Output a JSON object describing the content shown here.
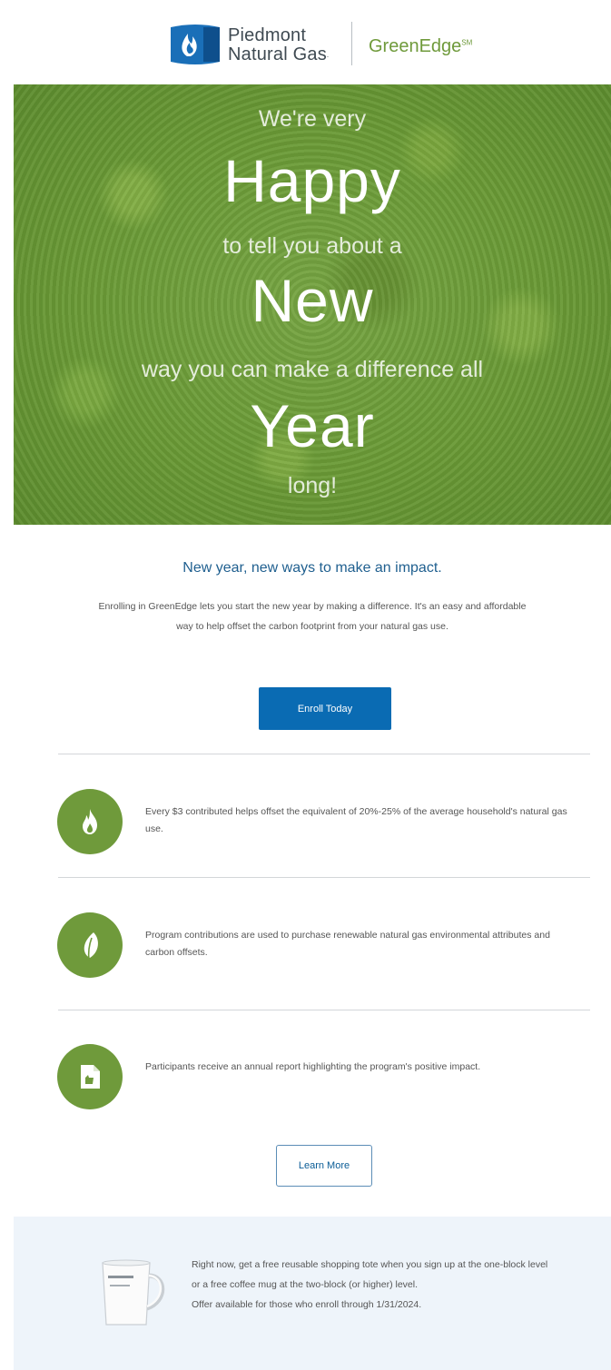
{
  "header": {
    "brand_line1": "Piedmont",
    "brand_line2": "Natural Gas",
    "brand_reg": ".",
    "program_name": "GreenEdge",
    "program_tm": "SM"
  },
  "hero": {
    "line1": "We're very",
    "line2": "Happy",
    "line3": "to tell you about a",
    "line4": "New",
    "line5": "way you can make a difference all",
    "line6": "Year",
    "line7": "long!"
  },
  "intro": {
    "headline": "New year, new ways to make an impact.",
    "body": "Enrolling in GreenEdge lets you start the new year by making a difference. It's an easy and affordable way to help offset the carbon footprint from your natural gas use.",
    "enroll_label": "Enroll Today"
  },
  "features": [
    {
      "icon": "flame-icon",
      "text": "Every $3 contributed helps offset the equivalent of 20%-25% of the average household's natural gas use."
    },
    {
      "icon": "leaf-icon",
      "text": "Program contributions are used to purchase renewable natural gas environmental attributes and carbon offsets."
    },
    {
      "icon": "document-icon",
      "text": "Participants receive an annual report highlighting the program's positive impact."
    }
  ],
  "learn_more_label": "Learn More",
  "offer": {
    "line1": "Right now, get a free reusable shopping tote when you sign up at the one-block level or a free coffee mug at the two-block (or higher) level.",
    "line2": "Offer available for those who enroll through 1/31/2024."
  },
  "colors": {
    "green": "#6f9a3b",
    "blue": "#0a6bb3",
    "headline_blue": "#1f5f8f",
    "offer_bg": "#eef4fa"
  }
}
